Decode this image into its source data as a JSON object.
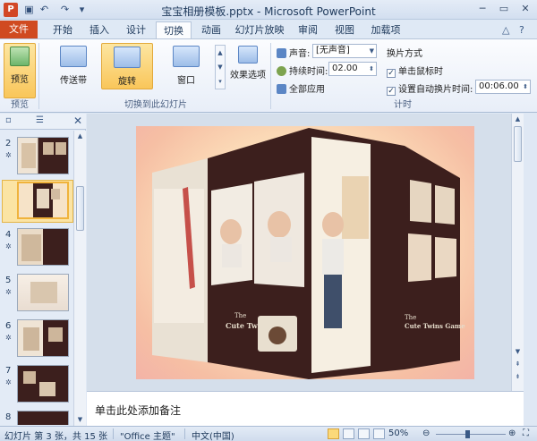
{
  "window": {
    "title": "宝宝相册模板.pptx - Microsoft PowerPoint",
    "app_icon": "P",
    "minimize": "─",
    "restore": "▭",
    "close": "✕"
  },
  "quick_access": [
    "save-icon",
    "undo-icon",
    "redo-icon",
    "customize-icon"
  ],
  "tabs": {
    "file": "文件",
    "items": [
      "开始",
      "插入",
      "设计",
      "切换",
      "动画",
      "幻灯片放映",
      "审阅",
      "视图",
      "加载项"
    ],
    "active": "切换"
  },
  "ribbon": {
    "preview": {
      "label": "预览",
      "group": "预览"
    },
    "transitions": {
      "items": [
        "传送带",
        "旋转",
        "窗口"
      ],
      "selected": "旋转",
      "effect_options": "效果选项",
      "group": "切换到此幻灯片"
    },
    "timing": {
      "sound_label": "声音:",
      "sound_value": "[无声音]",
      "duration_label": "持续时间:",
      "duration_value": "02.00",
      "apply_all": "全部应用",
      "advance_label": "换片方式",
      "on_click_label": "单击鼠标时",
      "on_click_checked": true,
      "after_label": "设置自动换片时间:",
      "after_checked": true,
      "after_value": "00:06.00",
      "group": "计时"
    }
  },
  "slide_pane": {
    "slides": [
      {
        "number": "2"
      },
      {
        "number": "3",
        "selected": true
      },
      {
        "number": "4"
      },
      {
        "number": "5"
      },
      {
        "number": "6"
      },
      {
        "number": "7"
      },
      {
        "number": "8"
      }
    ]
  },
  "slide": {
    "title_lines": [
      "The",
      "Cute Twins Game"
    ]
  },
  "notes": {
    "placeholder": "单击此处添加备注"
  },
  "status": {
    "slide_info": "幻灯片 第 3 张，共 15 张",
    "theme": "\"Office 主题\"",
    "language": "中文(中国)",
    "zoom": "50%"
  },
  "colors": {
    "accent": "#d04a20",
    "selection": "#f0b33c",
    "ribbon": "#fbfcfe",
    "cube_dark": "#3c1f1d"
  }
}
